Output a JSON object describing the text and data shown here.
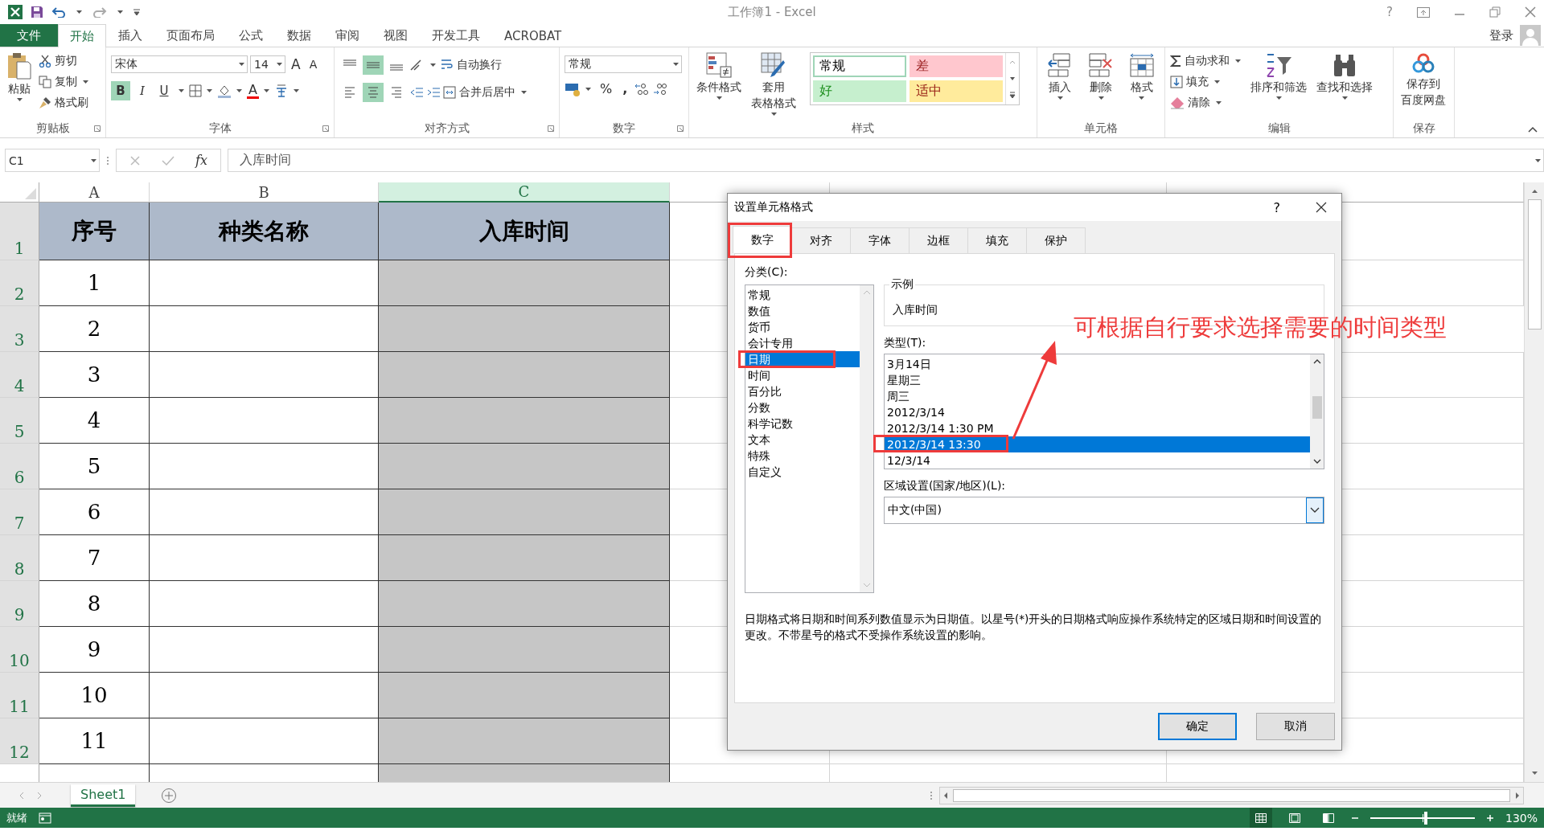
{
  "window": {
    "title": "工作簿1 - Excel",
    "help": "?"
  },
  "ribbon_tabs": [
    {
      "label": "文件",
      "kind": "file",
      "selected": false
    },
    {
      "label": "开始",
      "kind": "tab",
      "selected": true
    },
    {
      "label": "插入",
      "kind": "tab",
      "selected": false
    },
    {
      "label": "页面布局",
      "kind": "tab",
      "selected": false
    },
    {
      "label": "公式",
      "kind": "tab",
      "selected": false
    },
    {
      "label": "数据",
      "kind": "tab",
      "selected": false
    },
    {
      "label": "审阅",
      "kind": "tab",
      "selected": false
    },
    {
      "label": "视图",
      "kind": "tab",
      "selected": false
    },
    {
      "label": "开发工具",
      "kind": "tab",
      "selected": false
    },
    {
      "label": "ACROBAT",
      "kind": "tab",
      "selected": false
    }
  ],
  "user": {
    "label": "登录"
  },
  "clipboard": {
    "label": "剪贴板",
    "paste": "粘贴",
    "cut": "剪切",
    "copy": "复制",
    "painter": "格式刷"
  },
  "font": {
    "label": "字体",
    "font_name": "宋体",
    "font_size": "14",
    "grow": "A",
    "shrink": "A",
    "font_color": "A",
    "styles": [
      {
        "label": "B",
        "kind": "bold",
        "on": true
      },
      {
        "label": "I",
        "kind": "italic",
        "on": false
      },
      {
        "label": "U",
        "kind": "underline",
        "on": false
      }
    ]
  },
  "alignment": {
    "label": "对齐方式",
    "wrap": "自动换行",
    "merge": "合并后居中",
    "vertical": [
      {
        "kind": "top",
        "on": false
      },
      {
        "kind": "middle",
        "on": true
      },
      {
        "kind": "bottom",
        "on": false
      }
    ],
    "horizontal": [
      {
        "kind": "left",
        "on": false
      },
      {
        "kind": "center",
        "on": true
      },
      {
        "kind": "right",
        "on": false
      }
    ]
  },
  "number": {
    "label": "数字",
    "format": "常规",
    "percent": "%",
    "comma": ","
  },
  "styles": {
    "label": "样式",
    "conditional": "条件格式",
    "table": [
      "套用",
      "表格格式"
    ],
    "cell_styles": [
      {
        "label": "常规",
        "color": "#ffffff",
        "selected": true
      },
      {
        "label": "差",
        "color": "#ffc7ce",
        "selected": false
      },
      {
        "label": "好",
        "color": "#c6efce",
        "selected": false
      },
      {
        "label": "适中",
        "color": "#ffeb9c",
        "selected": false
      }
    ]
  },
  "cells": {
    "label": "单元格",
    "buttons": [
      {
        "label": "插入",
        "kind": "insert"
      },
      {
        "label": "删除",
        "kind": "delete"
      },
      {
        "label": "格式",
        "kind": "format"
      }
    ]
  },
  "editing": {
    "label": "编辑",
    "autosum": "自动求和",
    "fill": "填充",
    "clear": "清除",
    "sort": "排序和筛选",
    "find": "查找和选择"
  },
  "save": {
    "label": "保存",
    "button": [
      "保存到",
      "百度网盘"
    ]
  },
  "formula_bar": {
    "name_box": "C1",
    "fx": "fx",
    "content": "入库时间"
  },
  "sheet": {
    "columns": [
      {
        "label": "A",
        "selected": false
      },
      {
        "label": "B",
        "selected": false
      },
      {
        "label": "C",
        "selected": true
      }
    ],
    "rows": [
      {
        "number": "1",
        "kind": "heading",
        "selected": true,
        "values": [
          "序号",
          "种类名称",
          "入库时间"
        ]
      },
      {
        "number": "2",
        "kind": "data",
        "selected": true,
        "values": [
          "1"
        ]
      },
      {
        "number": "3",
        "kind": "data",
        "selected": true,
        "values": [
          "2"
        ]
      },
      {
        "number": "4",
        "kind": "data",
        "selected": true,
        "values": [
          "3"
        ]
      },
      {
        "number": "5",
        "kind": "data",
        "selected": true,
        "values": [
          "4"
        ]
      },
      {
        "number": "6",
        "kind": "data",
        "selected": true,
        "values": [
          "5"
        ]
      },
      {
        "number": "7",
        "kind": "data",
        "selected": true,
        "values": [
          "6"
        ]
      },
      {
        "number": "8",
        "kind": "data",
        "selected": true,
        "values": [
          "7"
        ]
      },
      {
        "number": "9",
        "kind": "data",
        "selected": true,
        "values": [
          "8"
        ]
      },
      {
        "number": "10",
        "kind": "data",
        "selected": true,
        "values": [
          "9"
        ]
      },
      {
        "number": "11",
        "kind": "data",
        "selected": true,
        "values": [
          "10"
        ]
      },
      {
        "number": "12",
        "kind": "data",
        "selected": true,
        "values": [
          "11"
        ]
      }
    ]
  },
  "sheet_tabs": [
    {
      "label": "Sheet1",
      "selected": true
    }
  ],
  "status_bar": {
    "status": "就绪",
    "views": [
      {
        "kind": "normal",
        "selected": true
      },
      {
        "kind": "layout",
        "selected": false
      },
      {
        "kind": "page_break",
        "selected": false
      }
    ],
    "zoom": {
      "level": 0.53,
      "reading": "130%"
    }
  },
  "dialog": {
    "title": "设置单元格格式",
    "help": "?",
    "tabs": [
      {
        "label": "数字",
        "selected": true
      },
      {
        "label": "对齐",
        "selected": false
      },
      {
        "label": "字体",
        "selected": false
      },
      {
        "label": "边框",
        "selected": false
      },
      {
        "label": "填充",
        "selected": false
      },
      {
        "label": "保护",
        "selected": false
      }
    ],
    "category_label": "分类(C):",
    "categories": [
      {
        "label": "常规",
        "selected": false
      },
      {
        "label": "数值",
        "selected": false
      },
      {
        "label": "货币",
        "selected": false
      },
      {
        "label": "会计专用",
        "selected": false
      },
      {
        "label": "日期",
        "selected": true
      },
      {
        "label": "时间",
        "selected": false
      },
      {
        "label": "百分比",
        "selected": false
      },
      {
        "label": "分数",
        "selected": false
      },
      {
        "label": "科学记数",
        "selected": false
      },
      {
        "label": "文本",
        "selected": false
      },
      {
        "label": "特殊",
        "selected": false
      },
      {
        "label": "自定义",
        "selected": false
      }
    ],
    "sample": {
      "label": "示例",
      "value": "入库时间"
    },
    "type_label": "类型(T):",
    "types": [
      {
        "label": "3月14日",
        "selected": false
      },
      {
        "label": "星期三",
        "selected": false
      },
      {
        "label": "周三",
        "selected": false
      },
      {
        "label": "2012/3/14",
        "selected": false
      },
      {
        "label": "2012/3/14 1:30 PM",
        "selected": false
      },
      {
        "label": "2012/3/14 13:30",
        "selected": true
      },
      {
        "label": "12/3/14",
        "selected": false
      }
    ],
    "locale_label": "区域设置(国家/地区)(L):",
    "locale": "中文(中国)",
    "description": "日期格式将日期和时间系列数值显示为日期值。以星号(*)开头的日期格式响应操作系统特定的区域日期和时间设置的更改。不带星号的格式不受操作系统设置的影响。",
    "buttons": [
      {
        "label": "确定",
        "kind": "default"
      },
      {
        "label": "取消",
        "kind": "normal"
      }
    ]
  },
  "annotation": {
    "text": "可根据自行要求选择需要的时间类型"
  }
}
